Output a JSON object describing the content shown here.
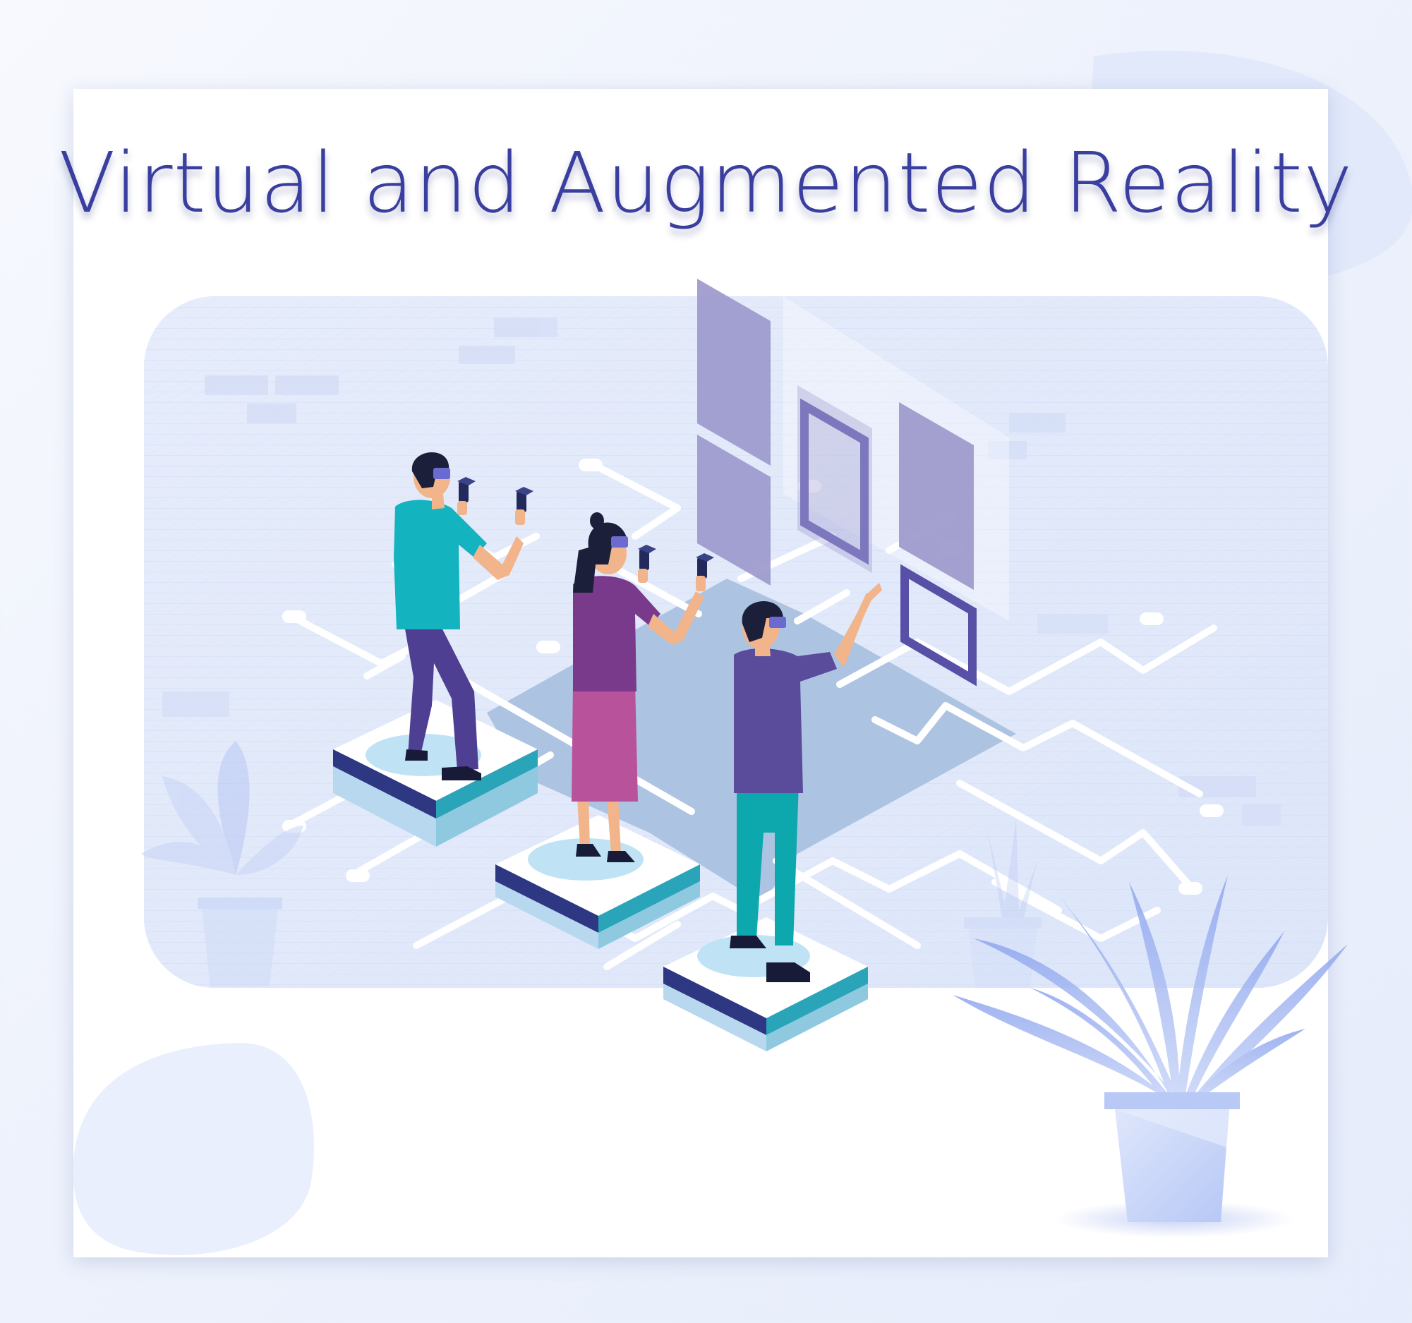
{
  "title": "Virtual and Augmented Reality",
  "colors": {
    "title": "#3a3f9f",
    "background": "#eef2fc",
    "panel": "#e3eafa",
    "platform_top": "#ffffff",
    "platform_side_dark": "#2e3782",
    "platform_side_teal": "#2aa4b8",
    "screen_fill": "#9c99cc",
    "screen_frame": "#5750a6",
    "shirt_teal": "#13b3bf",
    "shirt_purple": "#7a3a8c",
    "skirt_pink": "#b7529b",
    "shirt_indigo": "#5a4c9a",
    "skin": "#f2b48a",
    "hair": "#1c1f3a",
    "plant": "#9fb3f0"
  },
  "illustration": {
    "people": [
      "man-with-controllers",
      "woman-with-controllers",
      "man-pointing"
    ],
    "icons": [
      "vr-headset-icon",
      "controller-icon",
      "plant-icon",
      "virtual-screen-icon"
    ]
  }
}
